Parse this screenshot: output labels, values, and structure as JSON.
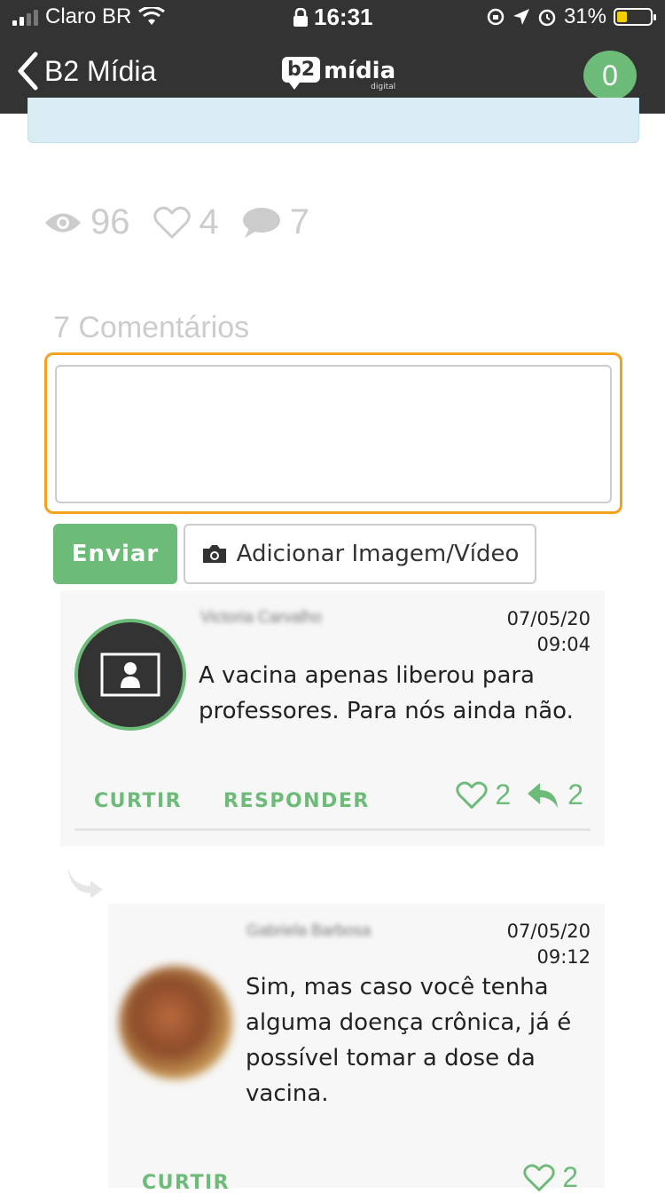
{
  "status_bar": {
    "carrier": "Claro BR",
    "time": "16:31",
    "battery": "31%",
    "battery_fraction": 0.31,
    "battery_color": "#f5d000"
  },
  "nav": {
    "back_label": "B2 Mídia",
    "logo_badge": "b2",
    "logo_word": "mídia",
    "logo_sub": "digital",
    "notification_count": "0",
    "accent": "#6dbb78"
  },
  "stats": {
    "views": "96",
    "likes": "4",
    "comments": "7",
    "icons": [
      "eye-icon",
      "heart-icon",
      "speech-bubble-icon"
    ]
  },
  "comments_section": {
    "title": "7 Comentários",
    "input_value": "",
    "send_label": "Enviar",
    "add_media_label": "Adicionar Imagem/Vídeo"
  },
  "comments": [
    {
      "author": "Victoria Carvalho",
      "date": "07/05/20",
      "time": "09:04",
      "text": "A vacina apenas liberou para professores. Para nós ainda não.",
      "like_label": "CURTIR",
      "reply_label": "RESPONDER",
      "likes": "2",
      "replies": "2"
    },
    {
      "author": "Gabriela Barbosa",
      "date": "07/05/20",
      "time": "09:12",
      "text": "Sim, mas caso você tenha alguma doença crônica, já é possível tomar a dose da vacina.",
      "like_label": "CURTIR",
      "likes": "2"
    }
  ]
}
